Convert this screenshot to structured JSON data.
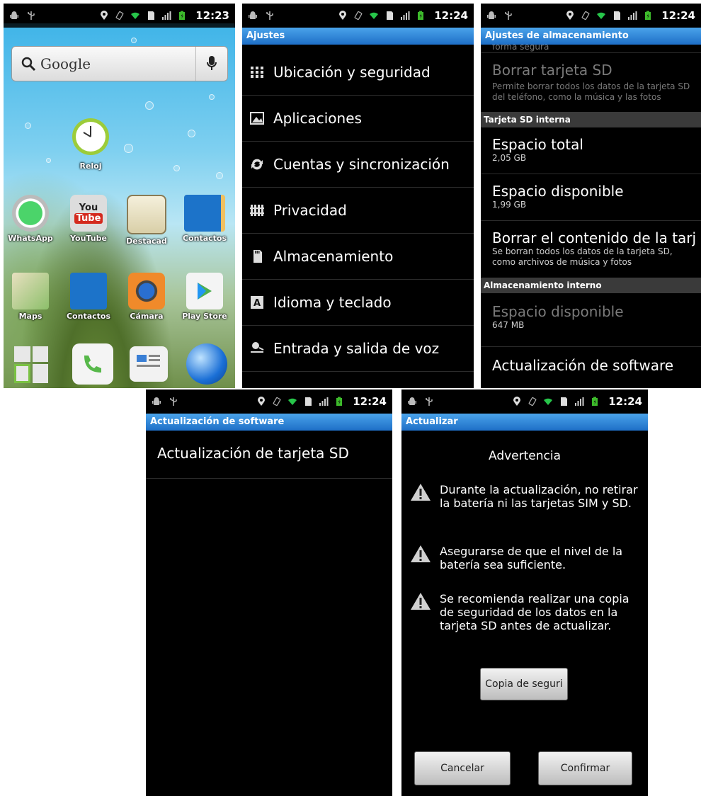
{
  "status_time_1": "12:23",
  "status_time": "12:24",
  "home": {
    "search_label": "Google",
    "clock_label": "Reloj",
    "apps_row1": [
      "WhatsApp",
      "YouTube",
      "Destacad",
      "Contactos"
    ],
    "apps_row2": [
      "Maps",
      "Contactos",
      "Cámara",
      "Play Store"
    ],
    "youtube_icon_text": [
      "You",
      "Tube"
    ]
  },
  "settings": {
    "title": "Ajustes",
    "items": [
      "Ubicación y seguridad",
      "Aplicaciones",
      "Cuentas y sincronización",
      "Privacidad",
      "Almacenamiento",
      "Idioma y teclado",
      "Entrada y salida de voz"
    ]
  },
  "storage": {
    "title": "Ajustes de almacenamiento",
    "top_fragment": "forma segura",
    "erase_sd_title": "Borrar tarjeta SD",
    "erase_sd_desc": "Permite borrar todos los datos de la tarjeta SD del teléfono, como la música y las fotos",
    "section_internal_sd": "Tarjeta SD interna",
    "total_label": "Espacio total",
    "total_value": "2,05 GB",
    "available_label": "Espacio disponible",
    "available_value": "1,99 GB",
    "erase_content_title": "Borrar el contenido de la tarj",
    "erase_content_desc": "Se borran todos los datos de la tarjeta SD, como archivos de música y fotos",
    "section_internal_storage": "Almacenamiento interno",
    "internal_available_label": "Espacio disponible",
    "internal_available_value": "647 MB",
    "software_update": "Actualización de software"
  },
  "software_update": {
    "title": "Actualización de software",
    "item": "Actualización de tarjeta SD"
  },
  "update": {
    "title": "Actualizar",
    "heading": "Advertencia",
    "warnings": [
      "Durante la actualización, no retirar la batería ni las tarjetas SIM y SD.",
      "Asegurarse de que el nivel de la batería sea suficiente.",
      "Se recomienda realizar una copia de seguridad de los datos en la tarjeta SD antes de actualizar."
    ],
    "backup_button": "Copia de seguri",
    "cancel_button": "Cancelar",
    "confirm_button": "Confirmar"
  }
}
